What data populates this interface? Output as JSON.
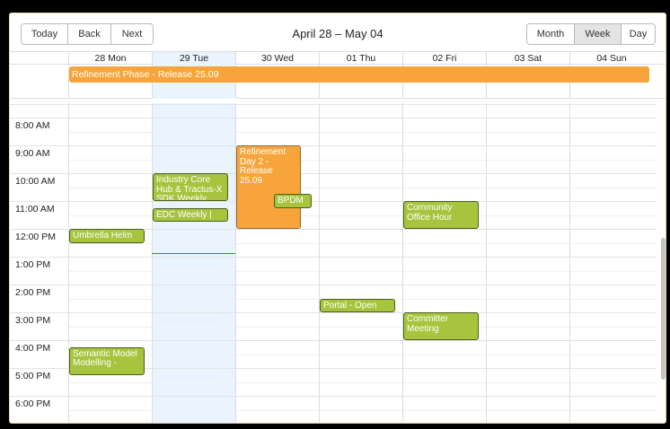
{
  "toolbar": {
    "today_label": "Today",
    "back_label": "Back",
    "next_label": "Next",
    "range_title": "April 28 – May 04",
    "views": [
      "Month",
      "Week",
      "Day"
    ],
    "active_view": "Week"
  },
  "days": [
    {
      "label": "28 Mon",
      "today": false
    },
    {
      "label": "29 Tue",
      "today": true
    },
    {
      "label": "30 Wed",
      "today": false
    },
    {
      "label": "01 Thu",
      "today": false
    },
    {
      "label": "02 Fri",
      "today": false
    },
    {
      "label": "03 Sat",
      "today": false
    },
    {
      "label": "04 Sun",
      "today": false
    }
  ],
  "allday_events": [
    {
      "title": "Refinement Phase - Release 25.09",
      "color": "#f7a53b"
    }
  ],
  "times": [
    "8:00 AM",
    "9:00 AM",
    "10:00 AM",
    "11:00 AM",
    "12:00 PM",
    "1:00 PM",
    "2:00 PM",
    "3:00 PM",
    "4:00 PM",
    "5:00 PM",
    "6:00 PM"
  ],
  "events": [
    {
      "title": "Industry Core Hub & Tractus-X SDK Weekly",
      "day": "29 Tue",
      "start": "10:00 AM",
      "end": "11:00 AM"
    },
    {
      "title": "EDC Weekly |",
      "day": "29 Tue",
      "start": "11:15 AM",
      "end": "11:45 AM"
    },
    {
      "title": "Refinement Day 2 - Release 25.09",
      "day": "30 Wed",
      "start": "9:00 AM",
      "end": "12:00 PM",
      "color": "#f7a53b"
    },
    {
      "title": "BPDM",
      "day": "30 Wed",
      "start": "10:45 AM",
      "end": "11:15 AM"
    },
    {
      "title": "Umbrella Helm",
      "day": "28 Mon",
      "start": "12:00 PM",
      "end": "12:30 PM"
    },
    {
      "title": "Community Office Hour",
      "day": "02 Fri",
      "start": "11:00 AM",
      "end": "12:00 PM"
    },
    {
      "title": "Portal - Open",
      "day": "01 Thu",
      "start": "2:30 PM",
      "end": "3:00 PM"
    },
    {
      "title": "Committer Meeting",
      "day": "02 Fri",
      "start": "3:00 PM",
      "end": "4:00 PM"
    },
    {
      "title": "Semantic Model Modelling -",
      "day": "28 Mon",
      "start": "4:15 PM",
      "end": "5:15 PM"
    }
  ],
  "colors": {
    "event_green": "#a6c43d",
    "event_orange": "#f7a53b",
    "today_bg": "#e9f4fe"
  }
}
